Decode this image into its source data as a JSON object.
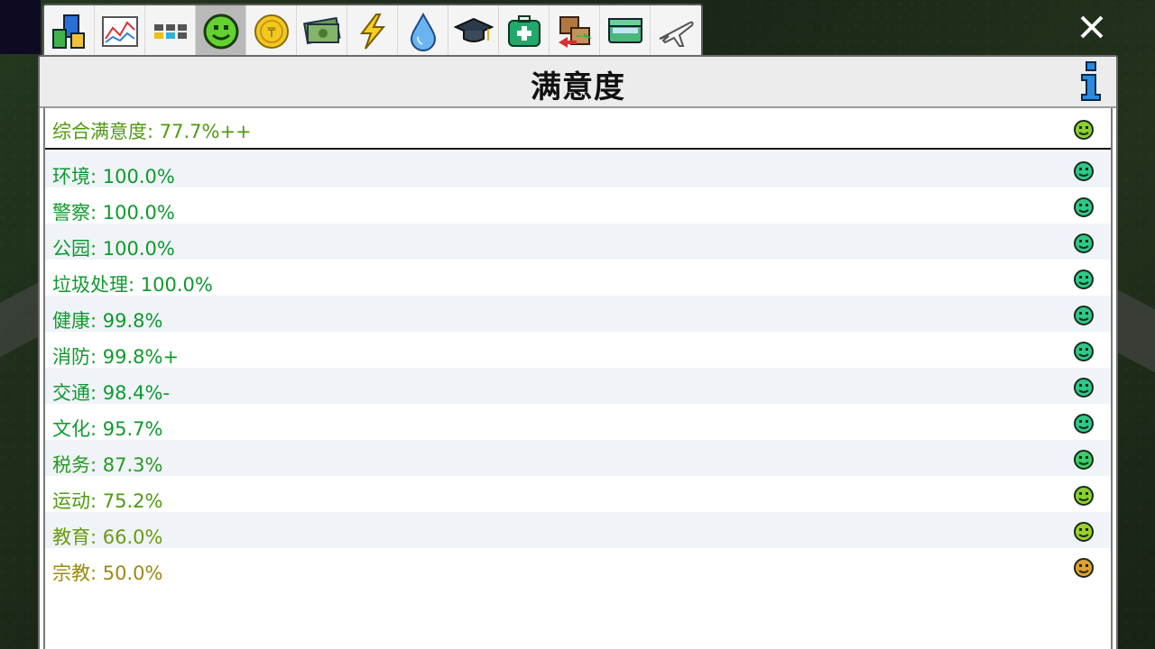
{
  "window": {
    "title": "满意度"
  },
  "tabs": [
    {
      "name": "buildings",
      "icon": "buildings-icon",
      "active": false
    },
    {
      "name": "graphs",
      "icon": "line-graph-icon",
      "active": false
    },
    {
      "name": "grid",
      "icon": "grid-icon",
      "active": false
    },
    {
      "name": "satisfaction",
      "icon": "smiley-icon",
      "active": true
    },
    {
      "name": "coin",
      "icon": "coin-icon",
      "active": false
    },
    {
      "name": "money",
      "icon": "money-icon",
      "active": false
    },
    {
      "name": "power",
      "icon": "lightning-icon",
      "active": false
    },
    {
      "name": "water",
      "icon": "water-drop-icon",
      "active": false
    },
    {
      "name": "education",
      "icon": "graduation-cap-icon",
      "active": false
    },
    {
      "name": "health",
      "icon": "medical-kit-icon",
      "active": false
    },
    {
      "name": "trade",
      "icon": "trade-icon",
      "active": false
    },
    {
      "name": "transport",
      "icon": "train-icon",
      "active": false
    },
    {
      "name": "airport",
      "icon": "airplane-icon",
      "active": false
    }
  ],
  "overall": {
    "label": "综合满意度: 77.7%++",
    "color": "#4f9a10",
    "face": "#8ad02e"
  },
  "rows": [
    {
      "label": "环境: 100.0%",
      "color": "#0e9a2e",
      "face": "#2ec88a"
    },
    {
      "label": "警察: 100.0%",
      "color": "#0e9a2e",
      "face": "#2ec88a"
    },
    {
      "label": "公园: 100.0%",
      "color": "#0e9a2e",
      "face": "#2ec88a"
    },
    {
      "label": "垃圾处理: 100.0%",
      "color": "#0e9a2e",
      "face": "#2ec88a"
    },
    {
      "label": "健康: 99.8%",
      "color": "#0e9a2e",
      "face": "#2ec88a"
    },
    {
      "label": "消防: 99.8%+",
      "color": "#0e9a2e",
      "face": "#2ec88a"
    },
    {
      "label": "交通: 98.4%-",
      "color": "#0e9a2e",
      "face": "#2ec88a"
    },
    {
      "label": "文化: 95.7%",
      "color": "#0e9a2e",
      "face": "#2ec88a"
    },
    {
      "label": "税务: 87.3%",
      "color": "#279a22",
      "face": "#3ccc68"
    },
    {
      "label": "运动: 75.2%",
      "color": "#4f9a10",
      "face": "#8ad02e"
    },
    {
      "label": "教育: 66.0%",
      "color": "#6a9a10",
      "face": "#9cd02a"
    },
    {
      "label": "宗教: 50.0%",
      "color": "#9a8a10",
      "face": "#e0a030"
    }
  ],
  "close_icon": "close-icon",
  "info_icon": "info-icon"
}
